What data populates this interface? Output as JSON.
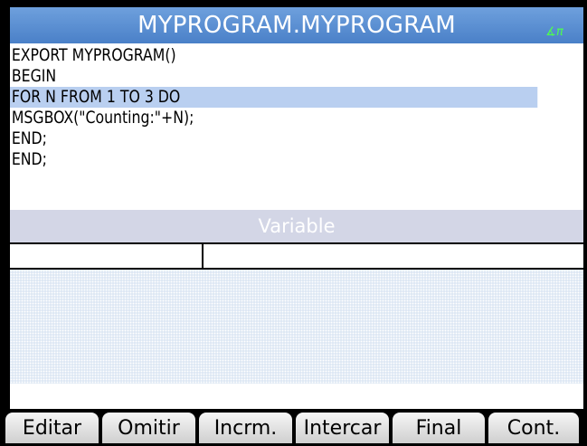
{
  "app": {
    "title": "MYPROGRAM.MYPROGRAM",
    "angle_indicator": "∡π"
  },
  "editor": {
    "lines": [
      "EXPORT MYPROGRAM()",
      "BEGIN",
      "FOR N FROM 1 TO 3 DO",
      "MSGBOX(\"Counting:\"+N);",
      "END;",
      "END;"
    ],
    "selected_line": 2
  },
  "variables": {
    "header": "Variable"
  },
  "menu": {
    "items": [
      "Editar",
      "Omitir",
      "Incrm.",
      "Intercar",
      "Final",
      "Cont."
    ]
  },
  "colors": {
    "title_bg": "#5a8fd6",
    "selection": "#b9cff0",
    "indicator": "#4dff4d"
  }
}
